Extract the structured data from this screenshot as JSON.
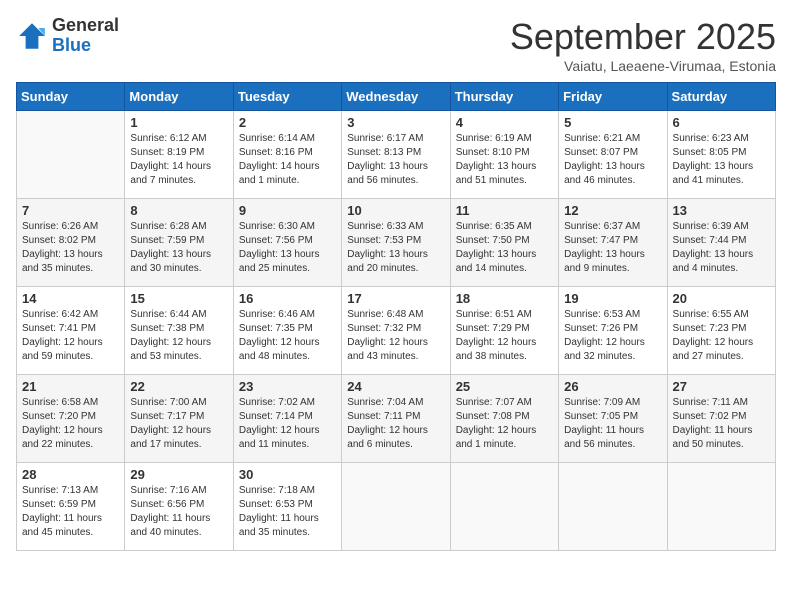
{
  "logo": {
    "general": "General",
    "blue": "Blue"
  },
  "header": {
    "month": "September 2025",
    "subtitle": "Vaiatu, Laeaene-Virumaa, Estonia"
  },
  "weekdays": [
    "Sunday",
    "Monday",
    "Tuesday",
    "Wednesday",
    "Thursday",
    "Friday",
    "Saturday"
  ],
  "weeks": [
    [
      {
        "day": "",
        "info": ""
      },
      {
        "day": "1",
        "info": "Sunrise: 6:12 AM\nSunset: 8:19 PM\nDaylight: 14 hours\nand 7 minutes."
      },
      {
        "day": "2",
        "info": "Sunrise: 6:14 AM\nSunset: 8:16 PM\nDaylight: 14 hours\nand 1 minute."
      },
      {
        "day": "3",
        "info": "Sunrise: 6:17 AM\nSunset: 8:13 PM\nDaylight: 13 hours\nand 56 minutes."
      },
      {
        "day": "4",
        "info": "Sunrise: 6:19 AM\nSunset: 8:10 PM\nDaylight: 13 hours\nand 51 minutes."
      },
      {
        "day": "5",
        "info": "Sunrise: 6:21 AM\nSunset: 8:07 PM\nDaylight: 13 hours\nand 46 minutes."
      },
      {
        "day": "6",
        "info": "Sunrise: 6:23 AM\nSunset: 8:05 PM\nDaylight: 13 hours\nand 41 minutes."
      }
    ],
    [
      {
        "day": "7",
        "info": "Sunrise: 6:26 AM\nSunset: 8:02 PM\nDaylight: 13 hours\nand 35 minutes."
      },
      {
        "day": "8",
        "info": "Sunrise: 6:28 AM\nSunset: 7:59 PM\nDaylight: 13 hours\nand 30 minutes."
      },
      {
        "day": "9",
        "info": "Sunrise: 6:30 AM\nSunset: 7:56 PM\nDaylight: 13 hours\nand 25 minutes."
      },
      {
        "day": "10",
        "info": "Sunrise: 6:33 AM\nSunset: 7:53 PM\nDaylight: 13 hours\nand 20 minutes."
      },
      {
        "day": "11",
        "info": "Sunrise: 6:35 AM\nSunset: 7:50 PM\nDaylight: 13 hours\nand 14 minutes."
      },
      {
        "day": "12",
        "info": "Sunrise: 6:37 AM\nSunset: 7:47 PM\nDaylight: 13 hours\nand 9 minutes."
      },
      {
        "day": "13",
        "info": "Sunrise: 6:39 AM\nSunset: 7:44 PM\nDaylight: 13 hours\nand 4 minutes."
      }
    ],
    [
      {
        "day": "14",
        "info": "Sunrise: 6:42 AM\nSunset: 7:41 PM\nDaylight: 12 hours\nand 59 minutes."
      },
      {
        "day": "15",
        "info": "Sunrise: 6:44 AM\nSunset: 7:38 PM\nDaylight: 12 hours\nand 53 minutes."
      },
      {
        "day": "16",
        "info": "Sunrise: 6:46 AM\nSunset: 7:35 PM\nDaylight: 12 hours\nand 48 minutes."
      },
      {
        "day": "17",
        "info": "Sunrise: 6:48 AM\nSunset: 7:32 PM\nDaylight: 12 hours\nand 43 minutes."
      },
      {
        "day": "18",
        "info": "Sunrise: 6:51 AM\nSunset: 7:29 PM\nDaylight: 12 hours\nand 38 minutes."
      },
      {
        "day": "19",
        "info": "Sunrise: 6:53 AM\nSunset: 7:26 PM\nDaylight: 12 hours\nand 32 minutes."
      },
      {
        "day": "20",
        "info": "Sunrise: 6:55 AM\nSunset: 7:23 PM\nDaylight: 12 hours\nand 27 minutes."
      }
    ],
    [
      {
        "day": "21",
        "info": "Sunrise: 6:58 AM\nSunset: 7:20 PM\nDaylight: 12 hours\nand 22 minutes."
      },
      {
        "day": "22",
        "info": "Sunrise: 7:00 AM\nSunset: 7:17 PM\nDaylight: 12 hours\nand 17 minutes."
      },
      {
        "day": "23",
        "info": "Sunrise: 7:02 AM\nSunset: 7:14 PM\nDaylight: 12 hours\nand 11 minutes."
      },
      {
        "day": "24",
        "info": "Sunrise: 7:04 AM\nSunset: 7:11 PM\nDaylight: 12 hours\nand 6 minutes."
      },
      {
        "day": "25",
        "info": "Sunrise: 7:07 AM\nSunset: 7:08 PM\nDaylight: 12 hours\nand 1 minute."
      },
      {
        "day": "26",
        "info": "Sunrise: 7:09 AM\nSunset: 7:05 PM\nDaylight: 11 hours\nand 56 minutes."
      },
      {
        "day": "27",
        "info": "Sunrise: 7:11 AM\nSunset: 7:02 PM\nDaylight: 11 hours\nand 50 minutes."
      }
    ],
    [
      {
        "day": "28",
        "info": "Sunrise: 7:13 AM\nSunset: 6:59 PM\nDaylight: 11 hours\nand 45 minutes."
      },
      {
        "day": "29",
        "info": "Sunrise: 7:16 AM\nSunset: 6:56 PM\nDaylight: 11 hours\nand 40 minutes."
      },
      {
        "day": "30",
        "info": "Sunrise: 7:18 AM\nSunset: 6:53 PM\nDaylight: 11 hours\nand 35 minutes."
      },
      {
        "day": "",
        "info": ""
      },
      {
        "day": "",
        "info": ""
      },
      {
        "day": "",
        "info": ""
      },
      {
        "day": "",
        "info": ""
      }
    ]
  ]
}
